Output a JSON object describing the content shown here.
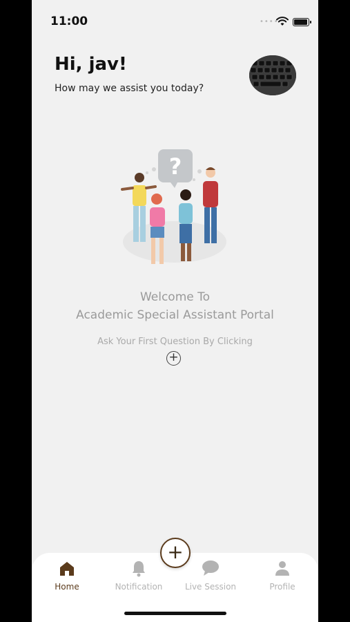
{
  "status_bar": {
    "time": "11:00",
    "signal_icon": "signal-dots-icon",
    "wifi_icon": "wifi-icon",
    "battery_icon": "battery-icon",
    "battery_level": 0.85
  },
  "header": {
    "greeting": "Hi, jav!",
    "subtitle": "How may we assist you today?",
    "avatar_icon": "keyboard-avatar"
  },
  "empty_state": {
    "illustration_icon": "people-question-illustration",
    "welcome_line1": "Welcome To",
    "welcome_line2": "Academic Special Assistant Portal",
    "hint": "Ask Your First Question By Clicking",
    "inline_add_icon": "plus-circle-icon"
  },
  "fab": {
    "icon": "plus-icon",
    "label": "+"
  },
  "nav": {
    "items": [
      {
        "label": "Home",
        "icon": "home-icon",
        "active": true
      },
      {
        "label": "Notification",
        "icon": "bell-icon",
        "active": false
      },
      {
        "label": "Live Session",
        "icon": "chat-bubble-icon",
        "active": false
      },
      {
        "label": "Profile",
        "icon": "person-icon",
        "active": false
      }
    ]
  },
  "colors": {
    "accent": "#5b3b1c",
    "inactive": "#b3b3b3",
    "background": "#f1f1f1",
    "text_muted": "#9a9a9a"
  }
}
